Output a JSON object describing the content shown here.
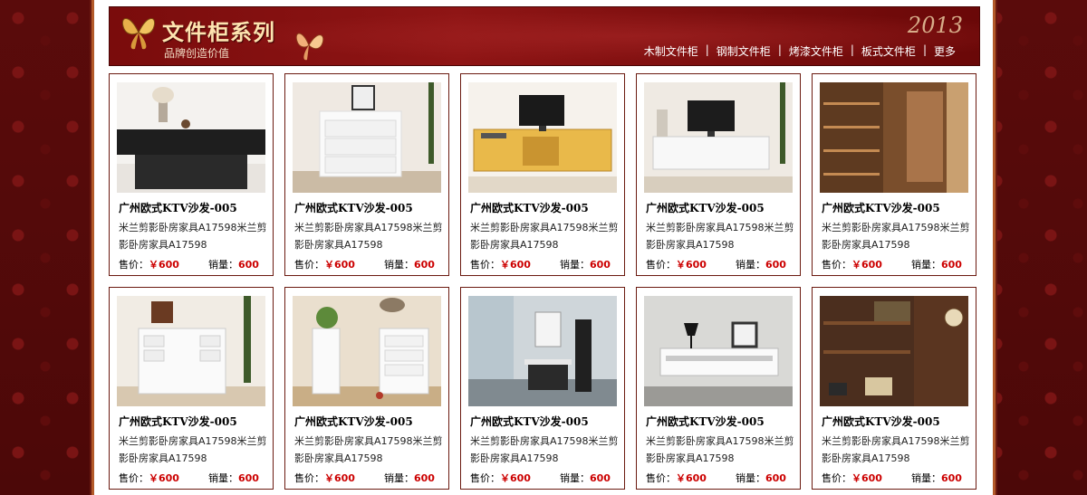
{
  "banner": {
    "title": "文件柜系列",
    "subtitle": "品牌创造价值",
    "year": "2013"
  },
  "nav": {
    "items": [
      "木制文件柜",
      "钢制文件柜",
      "烤漆文件柜",
      "板式文件柜",
      "更多"
    ],
    "separator": "|"
  },
  "products": [
    {
      "name": "广州欧式KTV沙发-005",
      "desc": "米兰剪影卧房家具A17598米兰剪影卧房家具A17598",
      "price_label": "售价：",
      "price": "￥600",
      "sales_label": "销量：",
      "sales": "600",
      "image": "black-sideboard"
    },
    {
      "name": "广州欧式KTV沙发-005",
      "desc": "米兰剪影卧房家具A17598米兰剪影卧房家具A17598",
      "price_label": "售价：",
      "price": "￥600",
      "sales_label": "销量：",
      "sales": "600",
      "image": "white-drawer-chest"
    },
    {
      "name": "广州欧式KTV沙发-005",
      "desc": "米兰剪影卧房家具A17598米兰剪影卧房家具A17598",
      "price_label": "售价：",
      "price": "￥600",
      "sales_label": "销量：",
      "sales": "600",
      "image": "wood-tv-cabinet"
    },
    {
      "name": "广州欧式KTV沙发-005",
      "desc": "米兰剪影卧房家具A17598米兰剪影卧房家具A17598",
      "price_label": "售价：",
      "price": "￥600",
      "sales_label": "销量：",
      "sales": "600",
      "image": "white-tv-cabinet"
    },
    {
      "name": "广州欧式KTV沙发-005",
      "desc": "米兰剪影卧房家具A17598米兰剪影卧房家具A17598",
      "price_label": "售价：",
      "price": "￥600",
      "sales_label": "销量：",
      "sales": "600",
      "image": "wood-shelving-room"
    },
    {
      "name": "广州欧式KTV沙发-005",
      "desc": "米兰剪影卧房家具A17598米兰剪影卧房家具A17598",
      "price_label": "售价：",
      "price": "￥600",
      "sales_label": "销量：",
      "sales": "600",
      "image": "white-desk"
    },
    {
      "name": "广州欧式KTV沙发-005",
      "desc": "米兰剪影卧房家具A17598米兰剪影卧房家具A17598",
      "price_label": "售价：",
      "price": "￥600",
      "sales_label": "销量：",
      "sales": "600",
      "image": "white-tall-chests"
    },
    {
      "name": "广州欧式KTV沙发-005",
      "desc": "米兰剪影卧房家具A17598米兰剪影卧房家具A17598",
      "price_label": "售价：",
      "price": "￥600",
      "sales_label": "销量：",
      "sales": "600",
      "image": "bathroom-vanity"
    },
    {
      "name": "广州欧式KTV沙发-005",
      "desc": "米兰剪影卧房家具A17598米兰剪影卧房家具A17598",
      "price_label": "售价：",
      "price": "￥600",
      "sales_label": "销量：",
      "sales": "600",
      "image": "white-tv-stand"
    },
    {
      "name": "广州欧式KTV沙发-005",
      "desc": "米兰剪影卧房家具A17598米兰剪影卧房家具A17598",
      "price_label": "售价：",
      "price": "￥600",
      "sales_label": "销量：",
      "sales": "600",
      "image": "wood-bookshelf"
    }
  ],
  "colors": {
    "accent_red": "#cc0000",
    "banner_red": "#8f1515",
    "border": "#6b1a10"
  }
}
